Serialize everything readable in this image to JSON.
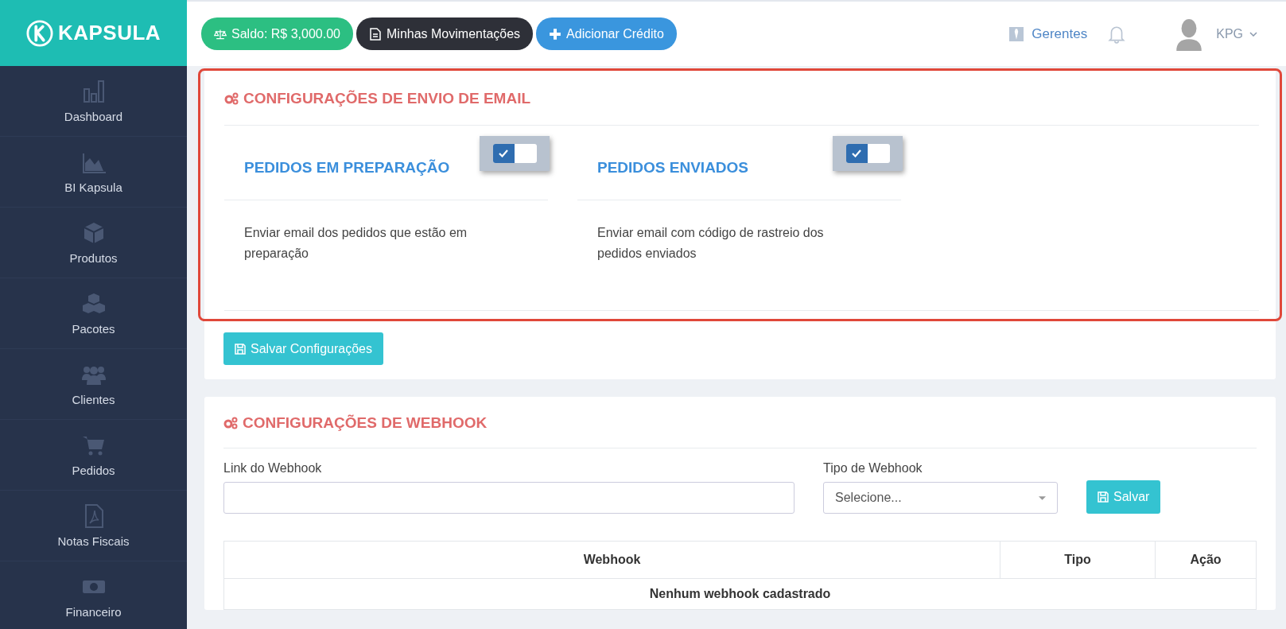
{
  "brand": {
    "name": "KAPSULA"
  },
  "top_bar": {
    "buttons": [
      {
        "label": "Saldo: R$ 3,000.00",
        "kind": "balance"
      },
      {
        "label": "Minhas Movimentações",
        "kind": "statement"
      },
      {
        "label": "Adicionar Crédito",
        "kind": "add"
      }
    ],
    "managers_link": "Gerentes",
    "user": "KPG"
  },
  "sidebar": {
    "items": [
      {
        "label": "Dashboard"
      },
      {
        "label": "BI Kapsula"
      },
      {
        "label": "Produtos"
      },
      {
        "label": "Pacotes"
      },
      {
        "label": "Clientes"
      },
      {
        "label": "Pedidos"
      },
      {
        "label": "Notas Fiscais"
      },
      {
        "label": "Financeiro"
      }
    ]
  },
  "email_settings": {
    "title": "CONFIGURAÇÕES DE ENVIO DE EMAIL",
    "options": [
      {
        "title": "PEDIDOS EM PREPARAÇÃO",
        "enabled": true,
        "description": "Enviar email dos pedidos que estão em preparação"
      },
      {
        "title": "PEDIDOS ENVIADOS",
        "enabled": true,
        "description": "Enviar email com código de rastreio dos pedidos enviados"
      }
    ],
    "save_button": "Salvar Configurações"
  },
  "webhook_settings": {
    "title": "CONFIGURAÇÕES DE WEBHOOK",
    "link_label": "Link do Webhook",
    "type_label": "Tipo de Webhook",
    "type_placeholder": "Selecione...",
    "save_button": "Salvar",
    "table": {
      "columns": [
        "Webhook",
        "Tipo",
        "Ação"
      ],
      "empty_message": "Nenhum webhook cadastrado"
    }
  }
}
